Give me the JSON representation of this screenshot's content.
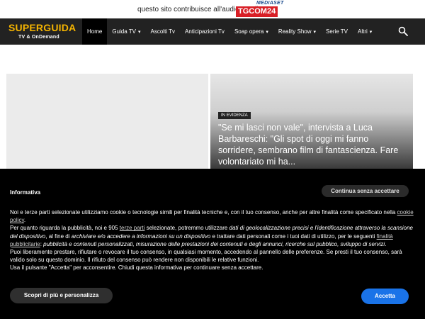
{
  "banner": {
    "tagline": "questo sito contribuisce all'audience di",
    "brand_top": "MEDIASET",
    "brand_main": "TGCOM",
    "brand_num": "24"
  },
  "logo": {
    "main": "SUPERGUIDA",
    "sub": "TV & OnDemand"
  },
  "nav": {
    "items": [
      {
        "label": "Home",
        "active": true,
        "dropdown": false
      },
      {
        "label": "Guida TV",
        "active": false,
        "dropdown": true
      },
      {
        "label": "Ascolti Tv",
        "active": false,
        "dropdown": false
      },
      {
        "label": "Anticipazioni Tv",
        "active": false,
        "dropdown": false
      },
      {
        "label": "Soap opera",
        "active": false,
        "dropdown": true
      },
      {
        "label": "Reality Show",
        "active": false,
        "dropdown": true
      },
      {
        "label": "Serie TV",
        "active": false,
        "dropdown": false
      },
      {
        "label": "Altri",
        "active": false,
        "dropdown": true
      }
    ]
  },
  "featured": {
    "badge": "IN EVIDENZA",
    "headline": "\"Se mi lasci non vale\", intervista a Luca Barbareschi: \"Gli spot di oggi mi fanno sorridere, sembrano film di fantascienza. Fare volontariato mi ha..."
  },
  "cookie": {
    "title": "Informativa",
    "continue_label": "Continua senza accettare",
    "p1_a": "Noi e terze parti selezionate utilizziamo cookie o tecnologie simili per finalità tecniche e, con il tuo consenso, anche per altre finalità come specificato nella ",
    "p1_link": "cookie policy",
    "p1_b": ".",
    "p2_a": "Per quanto riguarda la pubblicità, noi e 905 ",
    "p2_link1": "terze parti",
    "p2_b": " selezionate, potremmo utilizzare ",
    "p2_em1": "dati di geolocalizzazione precisi e l'identificazione attraverso la scansione del dispositivo",
    "p2_c": ", al fine di ",
    "p2_em2": "archiviare e/o accedere a informazioni su un dispositivo",
    "p2_d": " e trattare dati personali come i tuoi dati di utilizzo, per le seguenti ",
    "p2_link2": "finalità pubblicitarie",
    "p2_e": ": ",
    "p2_em3": "pubblicità e contenuti personalizzati, misurazione delle prestazioni dei contenuti e degli annunci, ricerche sul pubblico, sviluppo di servizi",
    "p2_f": ".",
    "p3": "Puoi liberamente prestare, rifiutare o revocare il tuo consenso, in qualsiasi momento, accedendo al pannello delle preferenze. Se presti il tuo consenso, sarà valido solo su questo dominio. Il rifiuto del consenso può rendere non disponibili le relative funzioni.",
    "p4": "Usa il pulsante \"Accetta\" per acconsentire. Chiudi questa informativa per continuare senza accettare.",
    "more_label": "Scopri di più e personalizza",
    "accept_label": "Accetta"
  },
  "colors": {
    "nav_bg": "#222222",
    "logo_accent": "#f5b400",
    "accept_blue": "#1a73e8",
    "tgcom_red": "#d81f26"
  }
}
